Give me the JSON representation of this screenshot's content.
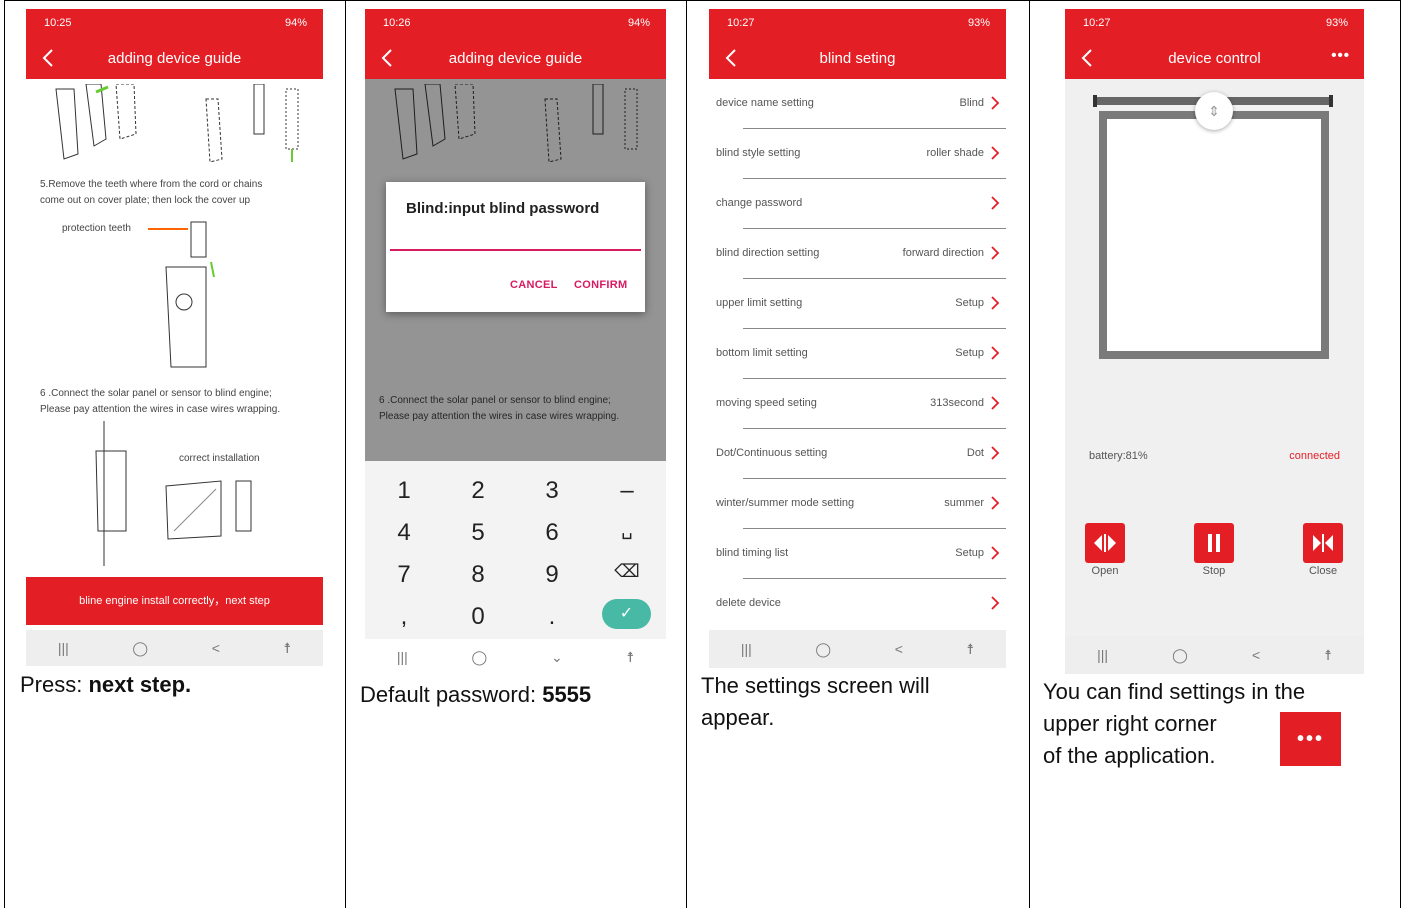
{
  "columns": [
    {
      "status": {
        "time": "10:25",
        "battery": "94%"
      },
      "appbar": {
        "title": "adding device guide"
      },
      "guide": {
        "step5_line1": "5.Remove the teeth where from the cord or chains",
        "step5_line2": "come out on cover plate; then lock the cover up",
        "protection_label": "protection teeth",
        "step6_line1": "6 .Connect the solar panel or sensor to blind engine;",
        "step6_line2": "Please pay attention the wires in case wires wrapping.",
        "correct_label": "correct installation"
      },
      "next_button": "bline engine install correctly，next step",
      "caption_prefix": "Press: ",
      "caption_bold": "next step."
    },
    {
      "status": {
        "time": "10:26",
        "battery": "94%"
      },
      "appbar": {
        "title": "adding device guide"
      },
      "guide": {
        "step6_line1": "6 .Connect the solar panel or sensor to blind engine;",
        "step6_line2": "Please pay attention the wires in case wires wrapping."
      },
      "dialog": {
        "title": "Blind:input blind password",
        "cancel": "CANCEL",
        "confirm": "CONFIRM"
      },
      "keypad": [
        "1",
        "2",
        "3",
        "–",
        "4",
        "5",
        "6",
        "␣",
        "7",
        "8",
        "9",
        "⌫",
        ",",
        "0",
        "."
      ],
      "caption_prefix": "Default password: ",
      "caption_bold": "5555"
    },
    {
      "status": {
        "time": "10:27",
        "battery": "93%"
      },
      "appbar": {
        "title": "blind seting"
      },
      "settings": [
        {
          "label": "device name setting",
          "value": "Blind"
        },
        {
          "label": "blind style setting",
          "value": "roller shade"
        },
        {
          "label": "change password",
          "value": ""
        },
        {
          "label": "blind direction setting",
          "value": "forward direction"
        },
        {
          "label": "upper limit setting",
          "value": "Setup"
        },
        {
          "label": "bottom limit setting",
          "value": "Setup"
        },
        {
          "label": "moving speed seting",
          "value": "313second"
        },
        {
          "label": "Dot/Continuous setting",
          "value": "Dot"
        },
        {
          "label": "winter/summer mode setting",
          "value": "summer"
        },
        {
          "label": "blind timing list",
          "value": "Setup"
        },
        {
          "label": "delete device",
          "value": ""
        }
      ],
      "caption_line1": "The settings screen will",
      "caption_line2": "appear."
    },
    {
      "status": {
        "time": "10:27",
        "battery": "93%"
      },
      "appbar": {
        "title": "device control",
        "more": "•••"
      },
      "battery_text": "battery:81%",
      "connection_text": "connected",
      "buttons": {
        "open": "Open",
        "stop": "Stop",
        "close": "Close"
      },
      "caption_line1": "You can find settings in the",
      "caption_line2": "upper right corner",
      "caption_line3": "of the application.",
      "caption_icon": "•••"
    }
  ],
  "colors": {
    "accent": "#e41e25",
    "dialog_accent": "#d81b60",
    "confirm_key": "#47b9a5"
  },
  "icons": [
    "back-arrow-icon",
    "chevron-right-icon",
    "more-dots-icon",
    "open-icon",
    "stop-icon",
    "close-icon",
    "nav-recents-icon",
    "nav-home-icon",
    "nav-back-icon",
    "accessibility-icon"
  ]
}
